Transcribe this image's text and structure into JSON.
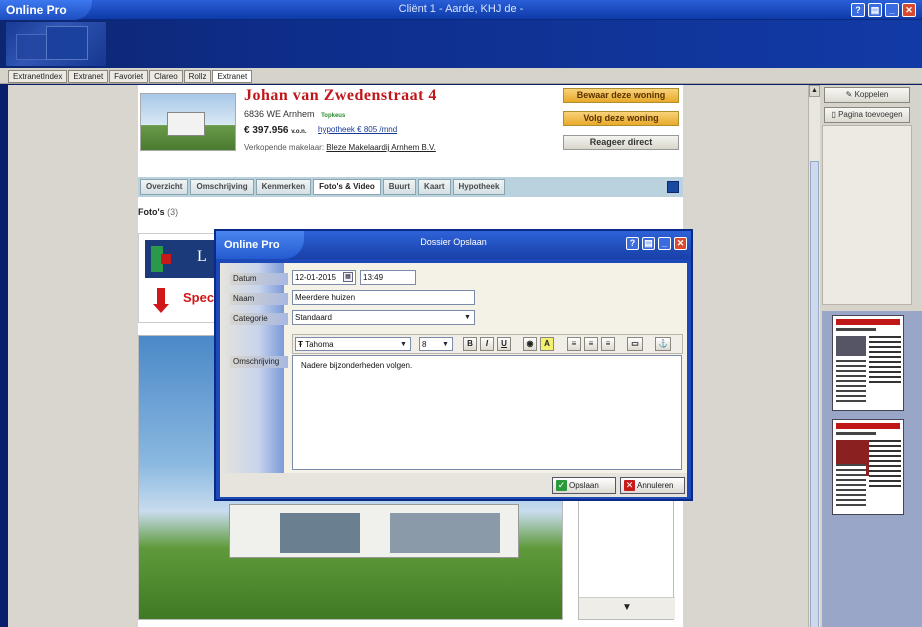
{
  "window": {
    "app_name": "Online Pro",
    "title": "Cliënt 1  -  Aarde, KHJ de  -",
    "controls": [
      "?",
      "▤",
      "_",
      "✕"
    ]
  },
  "tabs": [
    "ExtranetIndex",
    "Extranet",
    "Favoriet",
    "Clareo",
    "Rollz",
    "Extranet"
  ],
  "listing": {
    "street": "Johan van Zwedenstraat 4",
    "postcode": "6836 WE Arnhem",
    "top_label": "Topkeus",
    "price": "€ 397.956",
    "price_suffix": "v.o.n.",
    "mortgage_link": "hypotheek € 805 /mnd",
    "broker_label": "Verkopende makelaar:",
    "broker_name": "Bleze Makelaardij Arnhem B.V.",
    "btn_save": "Bewaar deze woning",
    "btn_follow": "Volg deze woning",
    "btn_react": "Reageer direct",
    "nav_tabs": [
      "Overzicht",
      "Omschrijving",
      "Kenmerken",
      "Foto's & Video",
      "Buurt",
      "Kaart",
      "Hypotheek"
    ],
    "photos_heading": "Foto's",
    "photos_count": "(3)",
    "banner_text": "Spec",
    "banner_logo_letter": "L"
  },
  "right_panel": {
    "btn_link": "Koppelen",
    "btn_add_page": "Pagina toevoegen"
  },
  "dialog": {
    "app_name": "Online Pro",
    "title": "Dossier Opslaan",
    "labels": {
      "date": "Datum",
      "name": "Naam",
      "category": "Categorie",
      "description": "Omschrijving"
    },
    "date_value": "12-01-2015",
    "time_value": "13:49",
    "name_value": "Meerdere huizen",
    "category_value": "Standaard",
    "font_value": "Tahoma",
    "size_value": "8",
    "toolbar": {
      "bold": "B",
      "italic": "I",
      "underline": "U"
    },
    "description_text": "Nadere bijzonderheden volgen.",
    "btn_save": "Opslaan",
    "btn_cancel": "Annuleren"
  },
  "colors": {
    "accent_red": "#c0161a",
    "titlebar_blue": "#1840a8",
    "orange_button": "#e8a92a"
  }
}
